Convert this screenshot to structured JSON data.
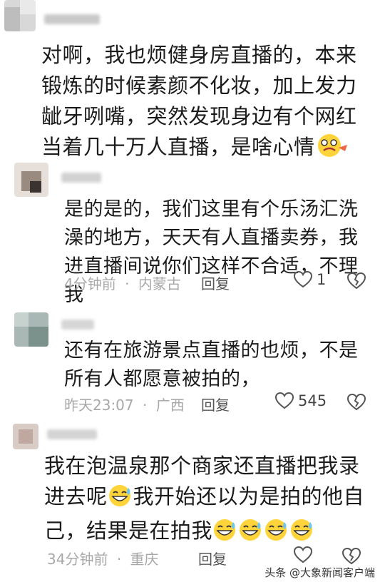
{
  "comments": [
    {
      "text": "对啊，我也烦健身房直播的，本来锻炼的时候素颜不化妆，加上发力龇牙咧嘴，突然发现身边有个网红当着几十万人直播，是啥心情",
      "emoji": "😵"
    },
    {
      "text": "是的是的，我们这里有个乐汤汇洗澡的地方，天天有人直播卖券，我进直播间说你们这样不合适，不理我",
      "time": "4分钟前",
      "location": "内蒙古",
      "reply_label": "回复",
      "likes": "1"
    },
    {
      "text": "还有在旅游景点直播的也烦，不是所有人都愿意被拍的，",
      "time": "昨天23:07",
      "location": "广西",
      "reply_label": "回复",
      "likes": "545"
    },
    {
      "text_part1": "我在泡温泉那个商家还直播把我录进去呢",
      "text_part2": "我开始还以为是拍的他自己，结果是在拍我",
      "emoji": "😅",
      "time": "34分钟前",
      "location": "重庆",
      "reply_label": "回复"
    }
  ],
  "meta_separator": "·",
  "footer": {
    "text": "头条 @大象新闻客户端"
  }
}
